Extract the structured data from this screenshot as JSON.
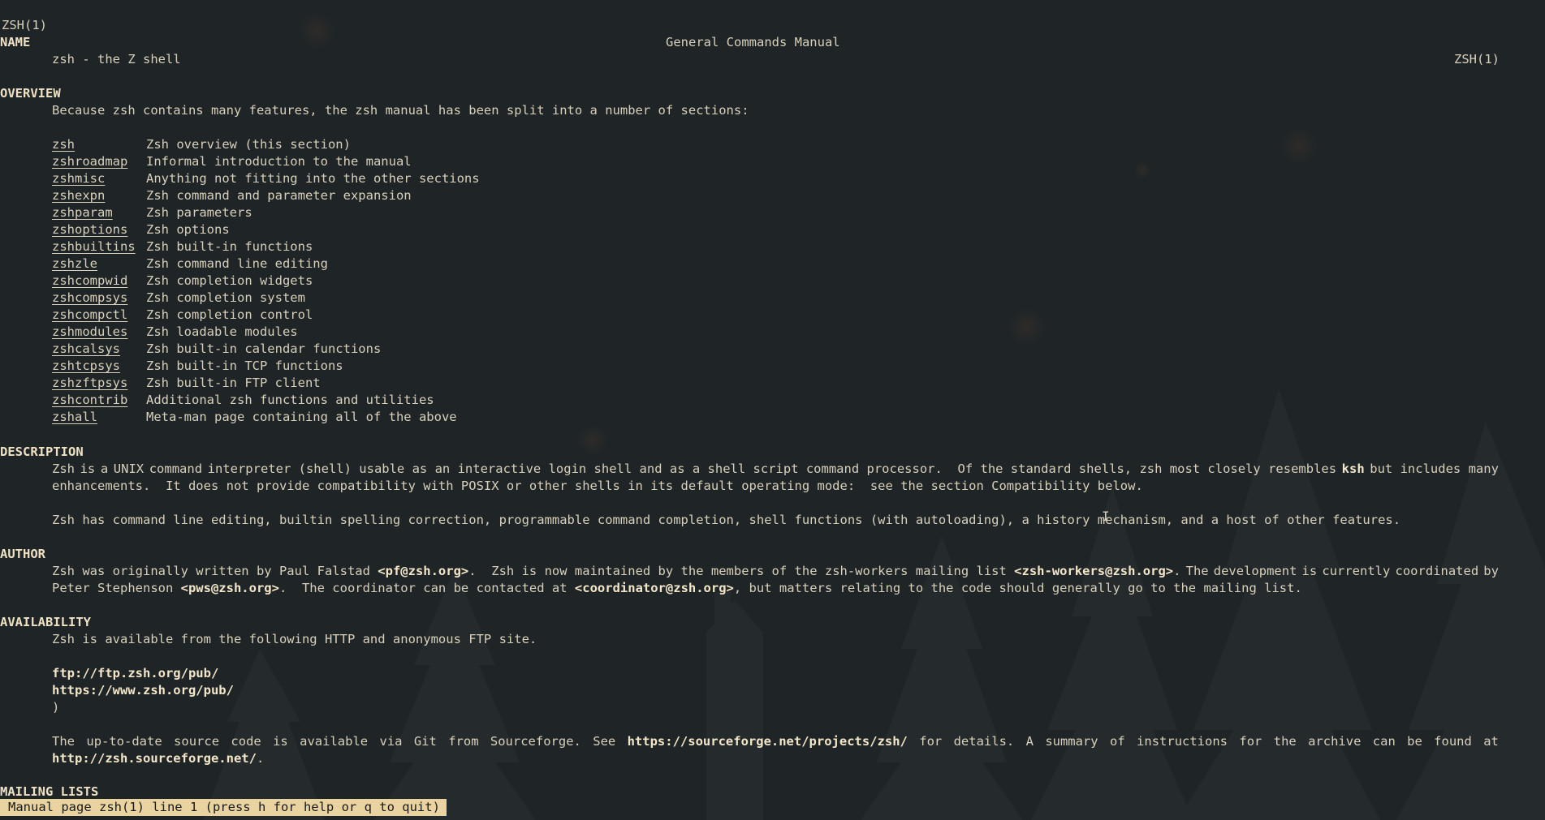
{
  "header": {
    "left": "ZSH(1)",
    "center": "General Commands Manual",
    "right": "ZSH(1)"
  },
  "name": {
    "heading": "NAME",
    "text": "zsh - the Z shell"
  },
  "overview": {
    "heading": "OVERVIEW",
    "intro": "Because zsh contains many features, the zsh manual has been split into a number of sections:",
    "sections": [
      {
        "name": "zsh",
        "desc": "Zsh overview (this section)"
      },
      {
        "name": "zshroadmap",
        "desc": "Informal introduction to the manual"
      },
      {
        "name": "zshmisc",
        "desc": "Anything not fitting into the other sections"
      },
      {
        "name": "zshexpn",
        "desc": "Zsh command and parameter expansion"
      },
      {
        "name": "zshparam",
        "desc": "Zsh parameters"
      },
      {
        "name": "zshoptions",
        "desc": "Zsh options"
      },
      {
        "name": "zshbuiltins",
        "desc": "Zsh built-in functions"
      },
      {
        "name": "zshzle",
        "desc": "Zsh command line editing"
      },
      {
        "name": "zshcompwid",
        "desc": "Zsh completion widgets"
      },
      {
        "name": "zshcompsys",
        "desc": "Zsh completion system"
      },
      {
        "name": "zshcompctl",
        "desc": "Zsh completion control"
      },
      {
        "name": "zshmodules",
        "desc": "Zsh loadable modules"
      },
      {
        "name": "zshcalsys",
        "desc": "Zsh built-in calendar functions"
      },
      {
        "name": "zshtcpsys",
        "desc": "Zsh built-in TCP functions"
      },
      {
        "name": "zshzftpsys",
        "desc": "Zsh built-in FTP client"
      },
      {
        "name": "zshcontrib",
        "desc": "Additional zsh functions and utilities"
      },
      {
        "name": "zshall",
        "desc": "Meta-man page containing all of the above"
      }
    ]
  },
  "description": {
    "heading": "DESCRIPTION",
    "p1_words": [
      "Zsh",
      "is",
      "a",
      "UNIX",
      "command",
      "interpreter (shell) usable as an interactive login shell and as a shell script command processor.  Of the standard shells, zsh most closely resembles"
    ],
    "p1_bold": "ksh",
    "p1_tail": "but includes many",
    "p1_line2": "enhancements.  It does not provide compatibility with POSIX or other shells in its default operating mode:  see the section Compatibility below.",
    "p2": "Zsh has command line editing, builtin spelling correction, programmable command completion, shell functions (with autoloading), a history mechanism, and a host of other features."
  },
  "author": {
    "heading": "AUTHOR",
    "l1_a": "Zsh was originally written by Paul Falstad ",
    "l1_email1": "<pf@zsh.org>",
    "l1_b": ".  Zsh is now maintained by the members of the zsh-workers mailing list ",
    "l1_email2": "<zsh-workers@zsh.org>",
    "l1_c_words": [
      ".",
      "The",
      "development",
      "is",
      "currently",
      "coordinated",
      "by"
    ],
    "l2_a": "Peter Stephenson ",
    "l2_email1": "<pws@zsh.org>",
    "l2_b": ".  The coordinator can be contacted at ",
    "l2_email2": "<coordinator@zsh.org>",
    "l2_c": ", but matters relating to the code should generally go to the mailing list."
  },
  "availability": {
    "heading": "AVAILABILITY",
    "intro": "Zsh is available from the following HTTP and anonymous FTP site.",
    "urls": [
      "ftp://ftp.zsh.org/pub/",
      "https://www.zsh.org/pub/"
    ],
    "close_paren": ")",
    "source_words": [
      "The",
      "up-to-date",
      "source",
      "code",
      "is",
      "available",
      "via",
      "Git",
      "from",
      "Sourceforge.",
      "See",
      "https://sourceforge.net/projects/zsh/",
      "for",
      "details.",
      "A",
      "summary",
      "of",
      "instructions",
      "for",
      "the",
      "archive",
      "can",
      "be",
      "found",
      "at"
    ],
    "source_url2": "http://zsh.sourceforge.net/",
    "source_tail": "."
  },
  "mailing_lists": {
    "heading": "MAILING LISTS"
  },
  "status_bar": {
    "text": "Manual page zsh(1) line 1 (press h for help or q to quit)"
  },
  "colors": {
    "background": "#1f2527",
    "text": "#d8d0bb",
    "status_bg": "#e9d3a0"
  }
}
